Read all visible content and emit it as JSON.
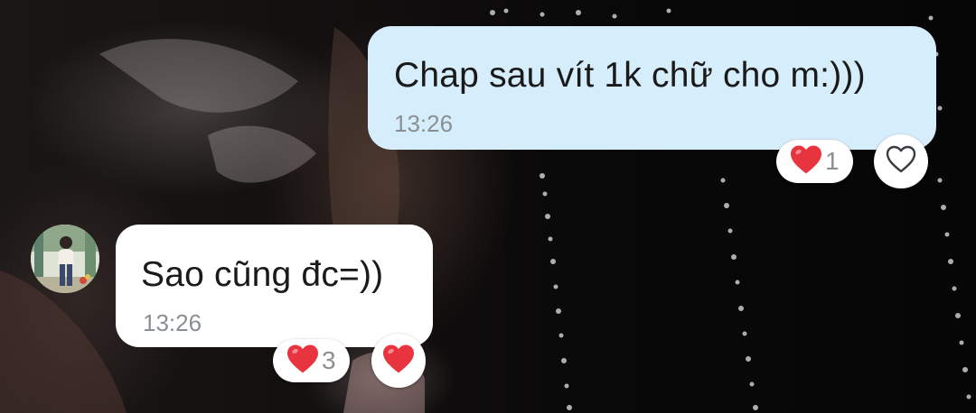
{
  "conversation": {
    "outgoing_message": {
      "text": "Chap sau vít 1k chữ cho m:)))",
      "time": "13:26",
      "reaction": {
        "icon": "red-heart-icon",
        "count": "1"
      },
      "react_button_icon": "heart-outline-icon"
    },
    "incoming_message": {
      "avatar_icon": "user-avatar",
      "text": "Sao cũng đc=))",
      "time": "13:26",
      "reaction": {
        "icon": "red-heart-icon",
        "count": "3"
      },
      "react_button_icon": "red-heart-icon"
    }
  },
  "colors": {
    "outgoing_bubble": "#d6edfb",
    "incoming_bubble": "#ffffff",
    "heart_red": "#e8343f",
    "timestamp": "#8a8f94"
  }
}
